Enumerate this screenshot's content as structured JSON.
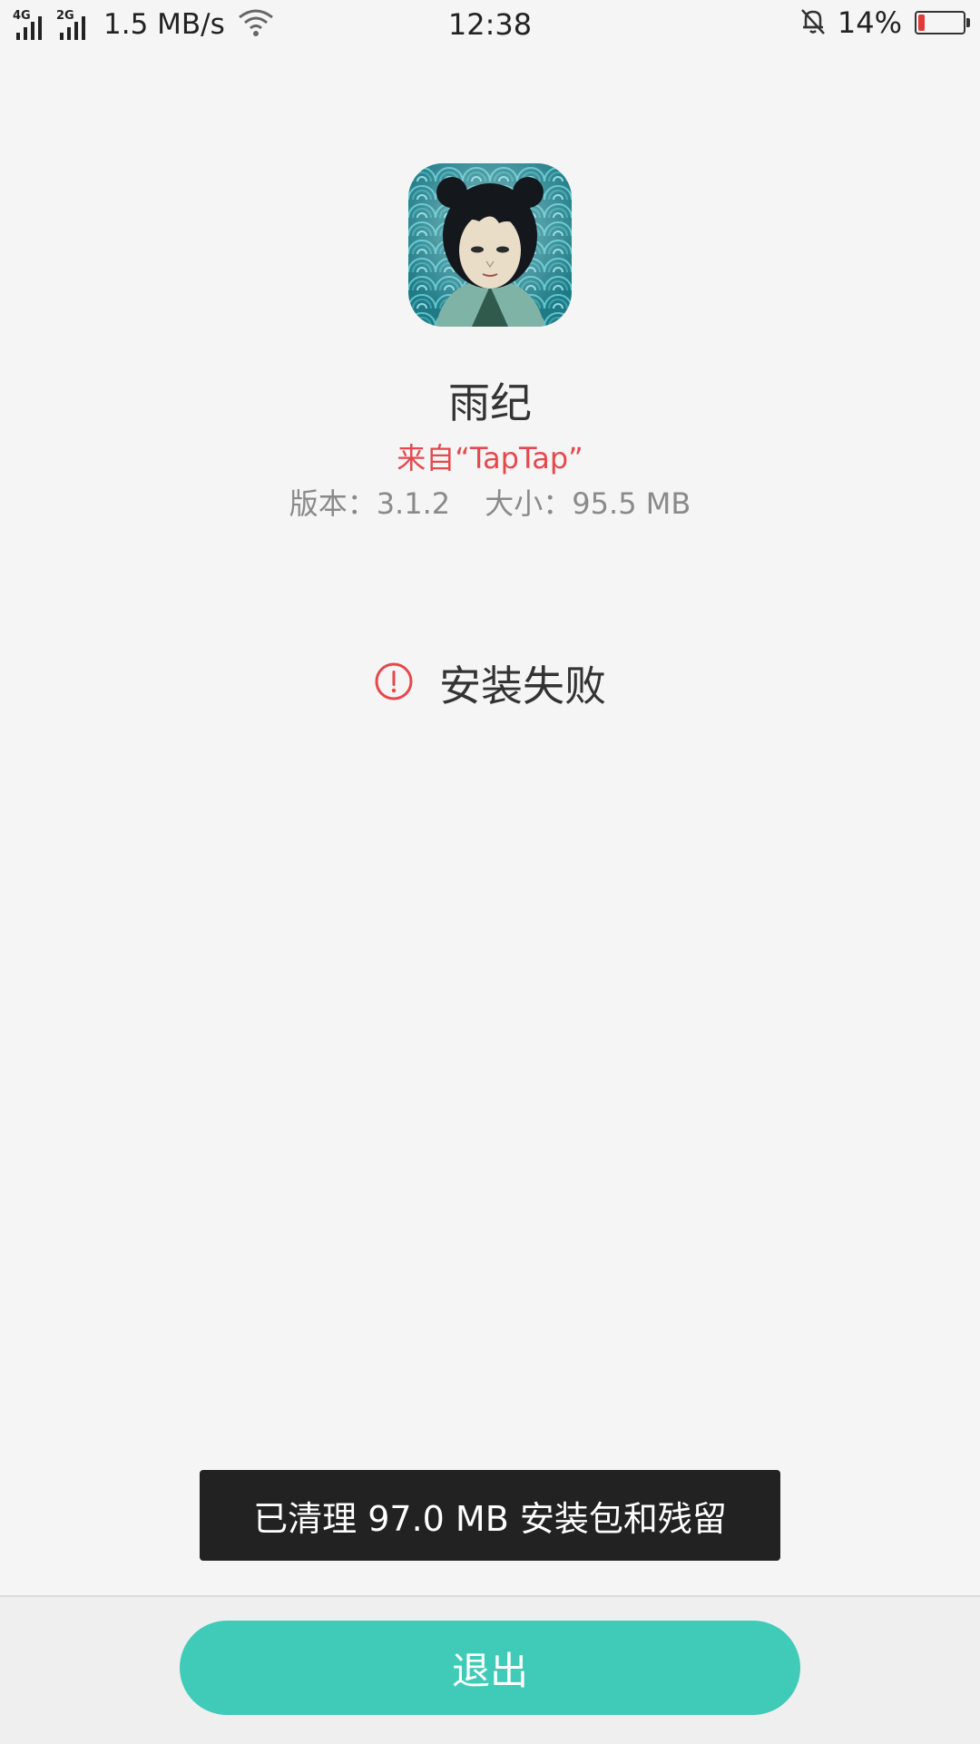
{
  "status_bar": {
    "network_1": "4G",
    "network_2": "2G",
    "speed": "1.5 MB/s",
    "time": "12:38",
    "battery_percent": "14%",
    "battery_level": 0.14,
    "battery_color": "#e53935",
    "icons": [
      "signal-icon",
      "wifi-icon",
      "bell-muted-icon",
      "battery-icon"
    ]
  },
  "app": {
    "name": "雨纪",
    "source": "来自“TapTap”",
    "version": "版本：3.1.2",
    "size": "大小：95.5 MB"
  },
  "result": {
    "icon": "alert-circle-icon",
    "text": "安装失败",
    "icon_color": "#e5484d"
  },
  "toast": {
    "text": "已清理 97.0 MB 安装包和残留"
  },
  "footer": {
    "exit_label": "退出",
    "exit_color": "#3fcbb8"
  }
}
